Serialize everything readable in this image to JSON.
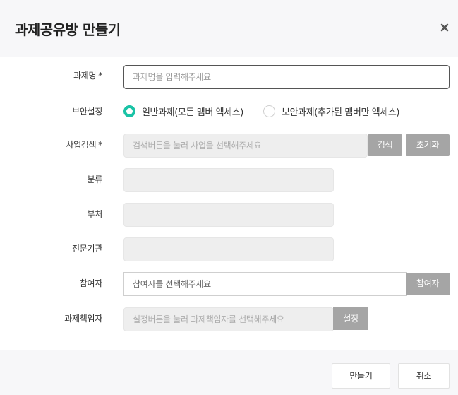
{
  "dialog": {
    "title": "과제공유방 만들기",
    "close_icon": "close-icon"
  },
  "form": {
    "task_name": {
      "label": "과제명",
      "required_mark": "*",
      "placeholder": "과제명을 입력해주세요",
      "value": ""
    },
    "security": {
      "label": "보안설정",
      "options": [
        {
          "label": "일반과제(모든 멤버 엑세스)",
          "selected": true
        },
        {
          "label": "보안과제(추가된 멤버만 엑세스)",
          "selected": false
        }
      ]
    },
    "project_search": {
      "label": "사업검색",
      "required_mark": "*",
      "placeholder": "검색버튼을 눌러 사업을 선택해주세요",
      "search_button": "검색",
      "reset_button": "초기화"
    },
    "category": {
      "label": "분류",
      "value": ""
    },
    "department": {
      "label": "부처",
      "value": ""
    },
    "agency": {
      "label": "전문기관",
      "value": ""
    },
    "participants": {
      "label": "참여자",
      "placeholder": "참여자를 선택해주세요",
      "button": "참여자"
    },
    "manager": {
      "label": "과제책임자",
      "placeholder": "설정버튼을 눌러 과제책임자를 선택해주세요",
      "button": "설정"
    }
  },
  "footer": {
    "create_button": "만들기",
    "cancel_button": "취소"
  },
  "colors": {
    "accent": "#1ac3a6",
    "button_gray": "#a5a5a5",
    "header_bg": "#f7f7f9"
  }
}
